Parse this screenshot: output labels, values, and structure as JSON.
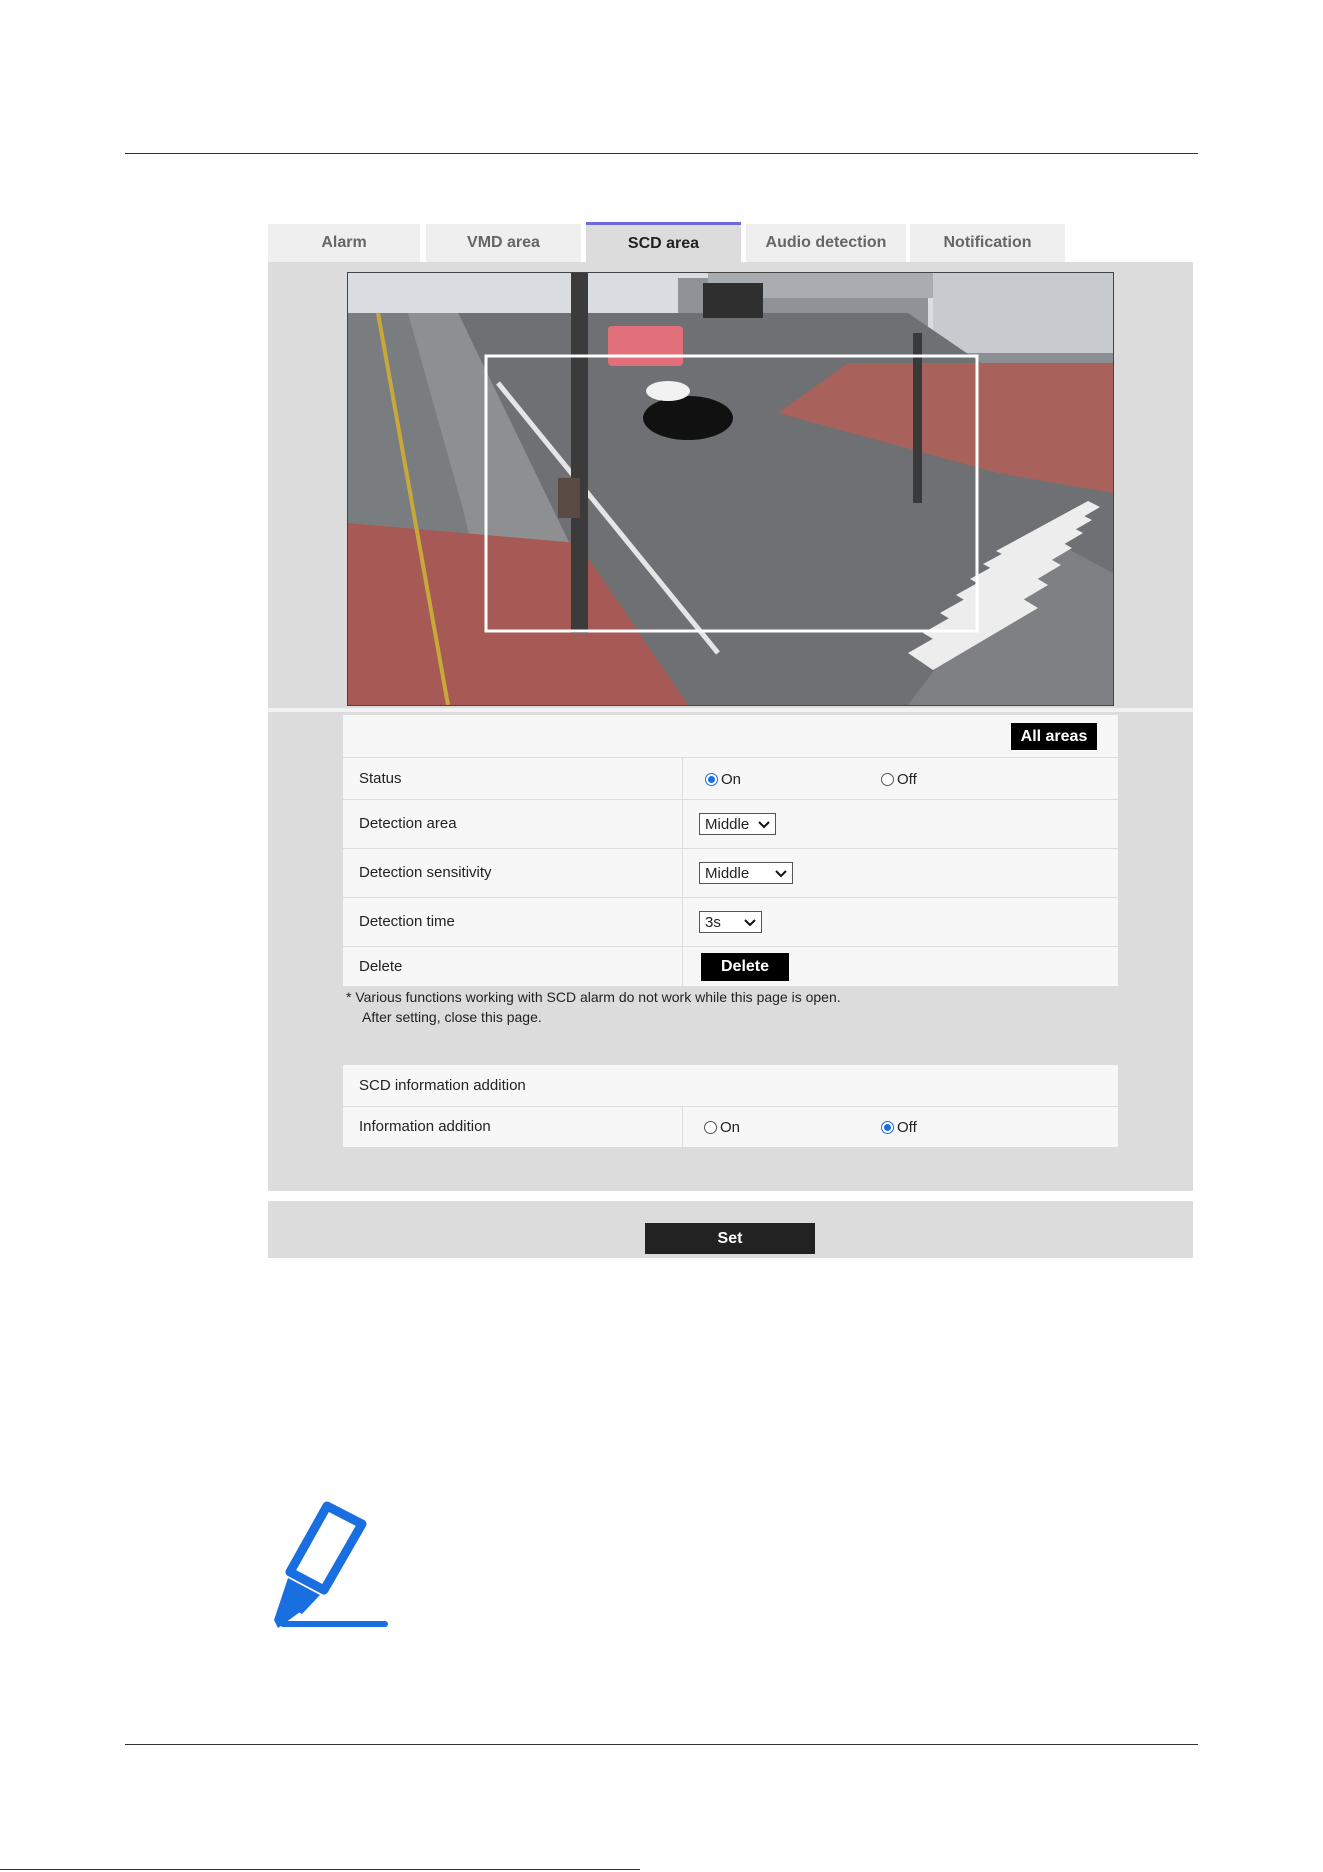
{
  "tabs": [
    {
      "label": "Alarm"
    },
    {
      "label": "VMD area"
    },
    {
      "label": "SCD area"
    },
    {
      "label": "Audio detection"
    },
    {
      "label": "Notification"
    }
  ],
  "active_tab": "SCD area",
  "all_areas_label": "All areas",
  "settings": {
    "status": {
      "label": "Status",
      "on": "On",
      "off": "Off",
      "selected": "On"
    },
    "detection_area": {
      "label": "Detection area",
      "value": "Middle"
    },
    "detection_sensitivity": {
      "label": "Detection sensitivity",
      "value": "Middle"
    },
    "detection_time": {
      "label": "Detection time",
      "value": "3s"
    },
    "delete": {
      "label": "Delete",
      "button": "Delete"
    }
  },
  "note": {
    "line1": "* Various functions working with SCD alarm do not work while this page is open.",
    "line2": "After setting, close this page."
  },
  "info_addition": {
    "heading": "SCD information addition",
    "label": "Information addition",
    "on": "On",
    "off": "Off",
    "selected": "Off"
  },
  "set_label": "Set",
  "colors": {
    "tab_accent": "#6b6bdf",
    "radio_selected": "#1a6fe0",
    "note_icon": "#1a6fe0"
  },
  "icons": {
    "note": "highlighter-pen-icon",
    "select": "chevron-down-icon"
  }
}
